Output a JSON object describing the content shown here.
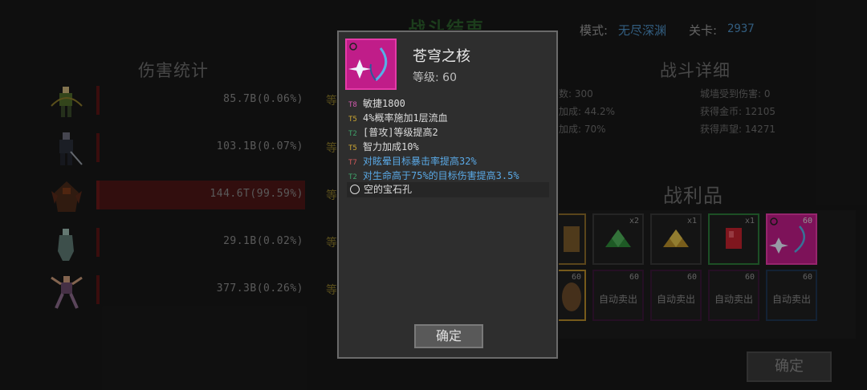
{
  "header": {
    "battle_title": "战斗结束",
    "mode_label": "模式:",
    "mode_value": "无尽深渊",
    "level_label": "关卡:",
    "level_value": "2937"
  },
  "damage_stats": {
    "title": "伤害统计",
    "rows": [
      {
        "value": "85.7B(0.06%)",
        "percent": 0.06,
        "extra": "等"
      },
      {
        "value": "103.1B(0.07%)",
        "percent": 0.07,
        "extra": "等"
      },
      {
        "value": "144.6T(99.59%)",
        "percent": 99.59,
        "extra": "等"
      },
      {
        "value": "29.1B(0.02%)",
        "percent": 0.02,
        "extra": "等"
      },
      {
        "value": "377.3B(0.26%)",
        "percent": 0.26,
        "extra": "等"
      }
    ]
  },
  "battle_detail": {
    "title": "战斗详细",
    "left": [
      "数: 300",
      "加成: 44.2%",
      "加成: 70%"
    ],
    "right": [
      "城墙受到伤害: 0",
      "获得金币: 12105",
      "获得声望: 14271"
    ]
  },
  "loot": {
    "title": "战利品",
    "row1": [
      {
        "count": "",
        "border": "#8a6a2a"
      },
      {
        "count": "x2",
        "border": "#4a4a4a",
        "gem": "#2f8a3a"
      },
      {
        "count": "x1",
        "border": "#4a4a4a",
        "gem": "#c9a431"
      },
      {
        "count": "x1",
        "border": "#2c7a3a",
        "gem": "#c4232f"
      },
      {
        "count": "60",
        "border": "#e63aa8",
        "fill": "#c01d89"
      }
    ],
    "row2": [
      {
        "count": "60",
        "border": "#b58a2a",
        "sell": ""
      },
      {
        "count": "60",
        "border": "#3a1838",
        "sell": "自动卖出"
      },
      {
        "count": "60",
        "border": "#3a1838",
        "sell": "自动卖出"
      },
      {
        "count": "60",
        "border": "#3a1838",
        "sell": "自动卖出"
      },
      {
        "count": "60",
        "border": "#1e3550",
        "sell": "自动卖出"
      }
    ]
  },
  "main_confirm": "确定",
  "tooltip": {
    "name": "苍穹之核",
    "level": "等级: 60",
    "affixes": [
      {
        "tier": "T8",
        "tier_color": "#d35ab0",
        "text": "敏捷1800",
        "color": "#dcdcdc"
      },
      {
        "tier": "T5",
        "tier_color": "#c9a431",
        "text": "4%概率施加1层流血",
        "color": "#dcdcdc"
      },
      {
        "tier": "T2",
        "tier_color": "#3fa36a",
        "text": "[普攻]等级提高2",
        "color": "#dcdcdc"
      },
      {
        "tier": "T5",
        "tier_color": "#c9a431",
        "text": "智力加成10%",
        "color": "#dcdcdc"
      },
      {
        "tier": "T7",
        "tier_color": "#d35a5a",
        "text": "对眩晕目标暴击率提高32%",
        "color": "#5aa9e6"
      },
      {
        "tier": "T2",
        "tier_color": "#3fa36a",
        "text": "对生命高于75%的目标伤害提高3.5%",
        "color": "#5aa9e6"
      }
    ],
    "gem_slot": "空的宝石孔",
    "confirm": "确定"
  }
}
